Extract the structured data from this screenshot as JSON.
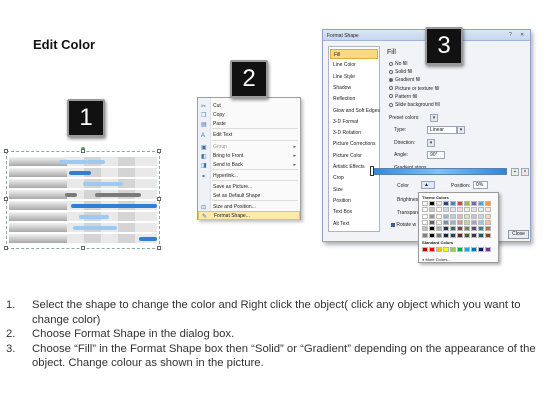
{
  "slide": {
    "title": "Edit Color"
  },
  "badges": [
    "1",
    "2",
    "3"
  ],
  "context_menu": {
    "items": [
      {
        "label": "Cut",
        "icon": "scissors-icon",
        "glyph": "✂",
        "dim": false,
        "arrow": false
      },
      {
        "label": "Copy",
        "icon": "copy-icon",
        "glyph": "❐",
        "dim": false,
        "arrow": false
      },
      {
        "label": "Paste",
        "icon": "paste-icon",
        "glyph": "▤",
        "dim": false,
        "arrow": false
      },
      {
        "label": "Edit Text",
        "icon": "edit-text-icon",
        "glyph": "A",
        "dim": false,
        "arrow": false
      },
      {
        "label": "Group",
        "icon": "group-icon",
        "glyph": "▣",
        "dim": true,
        "arrow": true
      },
      {
        "label": "Bring to Front",
        "icon": "bring-to-front-icon",
        "glyph": "◧",
        "dim": false,
        "arrow": true
      },
      {
        "label": "Send to Back",
        "icon": "send-to-back-icon",
        "glyph": "◨",
        "dim": false,
        "arrow": true
      },
      {
        "label": "Hyperlink...",
        "icon": "hyperlink-icon",
        "glyph": "⚭",
        "dim": false,
        "arrow": false
      },
      {
        "label": "Save as Picture...",
        "icon": "",
        "glyph": "",
        "dim": false,
        "arrow": false
      },
      {
        "label": "Set as Default Shape",
        "icon": "",
        "glyph": "",
        "dim": false,
        "arrow": false
      },
      {
        "label": "Size and Position...",
        "icon": "size-position-icon",
        "glyph": "⊡",
        "dim": false,
        "arrow": false
      },
      {
        "label": "Format Shape...",
        "icon": "format-shape-icon",
        "glyph": "✎",
        "dim": false,
        "arrow": false
      }
    ],
    "highlighted": "Format Shape..."
  },
  "dialog": {
    "title": "Format Shape",
    "title_buttons": [
      "?",
      "✕"
    ],
    "categories": [
      "Fill",
      "Line Color",
      "Line Style",
      "Shadow",
      "Reflection",
      "Glow and Soft Edges",
      "3-D Format",
      "3-D Rotation",
      "Picture Corrections",
      "Picture Color",
      "Artistic Effects",
      "Crop",
      "Size",
      "Position",
      "Text Box",
      "Alt Text"
    ],
    "selected_category": "Fill",
    "section_title": "Fill",
    "fill_options": [
      {
        "label": "No fill",
        "checked": false
      },
      {
        "label": "Solid fill",
        "checked": false
      },
      {
        "label": "Gradient fill",
        "checked": true
      },
      {
        "label": "Picture or texture fill",
        "checked": false
      },
      {
        "label": "Pattern fill",
        "checked": false
      },
      {
        "label": "Slide background fill",
        "checked": false
      }
    ],
    "preset_colors_label": "Preset colors:",
    "type_label": "Type:",
    "type_value": "Linear",
    "direction_label": "Direction:",
    "angle_label": "Angle:",
    "angle_value": "90°",
    "gradient_stops_label": "Gradient stops",
    "color_label": "Color",
    "position_label": "Position:",
    "position_value": "0%",
    "brightness_label": "Brightness",
    "transparency_label": "Transparen",
    "rotate_label": "Rotate w",
    "close_label": "Close"
  },
  "palette": {
    "theme_title": "Theme Colors",
    "standard_title": "Standard Colors",
    "more_colors": "More Colors...",
    "theme_top": [
      "#ffffff",
      "#000000",
      "#eeece1",
      "#1f497d",
      "#4f81bd",
      "#c0504d",
      "#9bbb59",
      "#8064a2",
      "#4bacc6",
      "#f79646"
    ],
    "standard": [
      "#c00000",
      "#ff0000",
      "#ffc000",
      "#ffff00",
      "#92d050",
      "#00b050",
      "#00b0f0",
      "#0070c0",
      "#002060",
      "#7030a0"
    ]
  },
  "instructions": [
    {
      "num": "1.",
      "text": "Select the shape to change the color and Right click the object( click any object which you want to change color)"
    },
    {
      "num": "2.",
      "text": "Choose Format Shape in the dialog box."
    },
    {
      "num": "3.",
      "text": "Choose “Fill” in the Format Shape box then “Solid” or “Gradient” depending on the appearance of the object. Change colour as shown in the picture."
    }
  ]
}
